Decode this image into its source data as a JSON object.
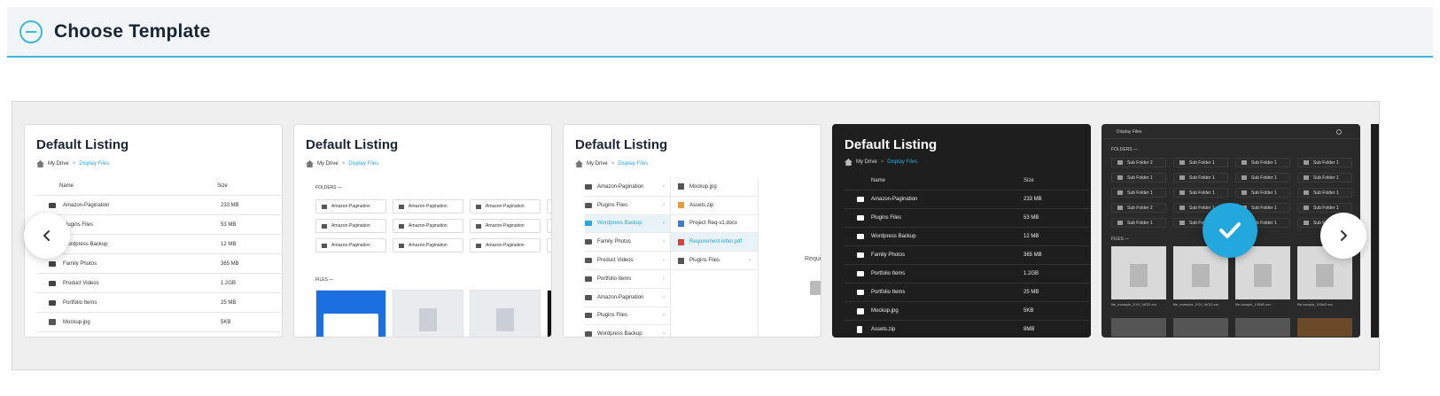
{
  "header": {
    "title": "Choose Template",
    "toggle_icon": "minus-circle-icon",
    "accent": "#3eb8d8"
  },
  "templates": [
    {
      "title": "Default Listing",
      "breadcrumb": {
        "root": "My Drive",
        "separator": ">",
        "current": "Display Files"
      },
      "columns": {
        "name": "Name",
        "size": "Size"
      },
      "rows": [
        {
          "name": "Amazon-Pagination",
          "size": "233 MB"
        },
        {
          "name": "Plugins Files",
          "size": "53 MB"
        },
        {
          "name": "Wordpress Backup",
          "size": "12 MB"
        },
        {
          "name": "Family Photos",
          "size": "365 MB"
        },
        {
          "name": "Product Videos",
          "size": "1.2GB"
        },
        {
          "name": "Portfolio Items",
          "size": "25 MB"
        },
        {
          "name": "Mockup.jpg",
          "size": "5KB"
        }
      ]
    },
    {
      "title": "Default Listing",
      "breadcrumb": {
        "root": "My Drive",
        "separator": ">",
        "current": "Display Files"
      },
      "folders_label": "FOLDERS —",
      "files_label": "FILES —",
      "folders": [
        "Amazon-Pagination",
        "Amazon-Pagination",
        "Amazon-Pagination",
        "Amazon-Pagination",
        "Amazon-Pagination",
        "Amazon-Pagination",
        "Amazon-Pagination",
        "Amazon-Pagination",
        "Amazon-Pagination"
      ]
    },
    {
      "title": "Default Listing",
      "breadcrumb": {
        "root": "My Drive",
        "separator": ">",
        "current": "Display Files"
      },
      "tree": [
        "Amazon-Pagination",
        "Plugins Files",
        "Wordpress Backup",
        "Family Photos",
        "Product Videos",
        "Portfolio Items",
        "Amazon-Pagination",
        "Plugins Files",
        "Wordpress Backup"
      ],
      "files": [
        "Mockup.jpg",
        "Assets.zip",
        "Project Req-v1.docx",
        "Requirement letter.pdf",
        "Plugins Files"
      ],
      "third_label": "Requi"
    },
    {
      "title": "Default Listing",
      "breadcrumb": {
        "root": "My Drive",
        "separator": ">",
        "current": "Display Files"
      },
      "columns": {
        "name": "Name",
        "size": "Size"
      },
      "rows": [
        {
          "name": "Amazon-Pagination",
          "size": "233 MB"
        },
        {
          "name": "Plugins Files",
          "size": "53 MB"
        },
        {
          "name": "Wordpress Backup",
          "size": "12 MB"
        },
        {
          "name": "Family Photos",
          "size": "365 MB"
        },
        {
          "name": "Portfolio Items",
          "size": "1.2GB"
        },
        {
          "name": "Portfolio Items",
          "size": "25 MB"
        },
        {
          "name": "Mockup.jpg",
          "size": "5KB"
        },
        {
          "name": "Assets.zip",
          "size": "8MB"
        }
      ]
    },
    {
      "top_title": "Display Files",
      "folders_label": "FOLDERS —",
      "files_label": "FILES —",
      "folders": [
        "Sub Folder 2",
        "Sub Folder 1",
        "Sub Folder 1",
        "Sub Folder 1",
        "Sub Folder 1",
        "Sub Folder 1",
        "Sub Folder 1",
        "Sub Folder 1",
        "Sub Folder 1",
        "Sub Folder 1",
        "Sub Folder 1",
        "Sub Folder 1",
        "Sub Folder 2",
        "Sub Folder 1",
        "Sub Folder 1",
        "Sub Folder 1",
        "Sub Folder 1",
        "Sub Folder 1",
        "Sub Folder 1",
        "Sub Folder 1"
      ],
      "files": [
        "file_example_XXX_MOD.xxx",
        "file_example_XXX_MOD.xxx",
        "file-sample_100kB.xxx",
        "file-sample_100kB.xxx"
      ],
      "selected": true
    }
  ],
  "nav": {
    "prev_icon": "chevron-left-icon",
    "next_icon": "chevron-right-icon"
  },
  "selection": {
    "icon": "checkmark-icon",
    "color": "#22a8dc"
  }
}
